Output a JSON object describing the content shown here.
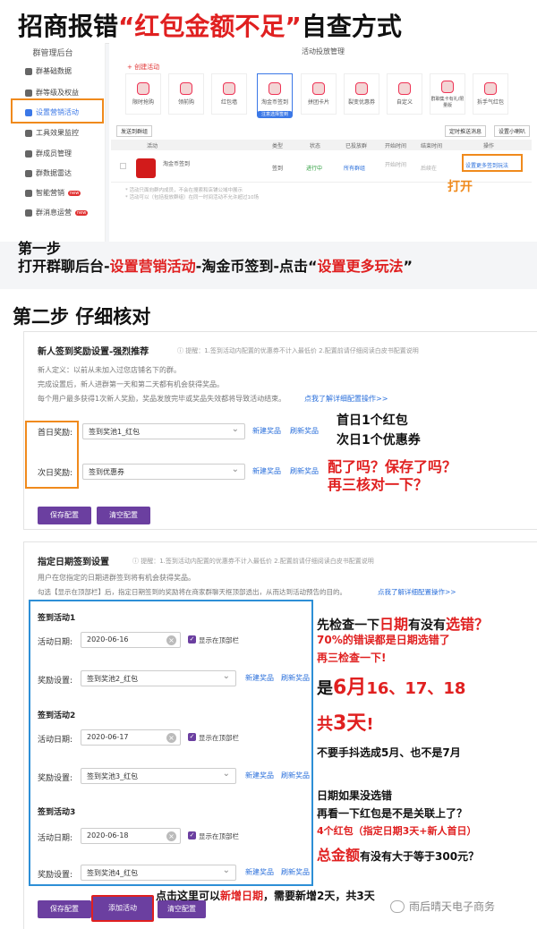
{
  "title": {
    "part1": "招商报错",
    "part2": "“红包金额不足”",
    "part3": "自查方式"
  },
  "admin": {
    "sidebar_title": "群管理后台",
    "sidebar_items": [
      "群基础数据",
      "群等级及权益",
      "设置营销活动",
      "工具效果监控",
      "群成员管理",
      "群数据雷达",
      "智能营销",
      "群消息运营"
    ],
    "badge_new": "new",
    "panel_title": "活动投放管理",
    "create_label": "+ 创建活动",
    "templates": [
      "限时抢购",
      "领前购",
      "红包墙",
      "淘金币签到",
      "拼团卡片",
      "裂变优惠券",
      "自定义",
      "群聊集卡有礼/限量版",
      "拆手气红包"
    ],
    "template_badge": "注意选择签到",
    "btn_send": "发送到群组",
    "btn_push": "定时推送消息",
    "btn_settings": "设置小喇叭",
    "columns": [
      "活动",
      "类型",
      "状态",
      "已投放群",
      "开始时间",
      "结束时间",
      "操作"
    ],
    "row": {
      "name": "淘金币签到",
      "type": "签到",
      "status": "进行中",
      "groups": "所有群组",
      "start": "开始时间",
      "end": "后续在",
      "op": "设置更多签到玩法"
    },
    "notes": [
      "* 活动只面向群内成员，不会在搜索和店铺公域中展示",
      "* 活动可以（包括投放群组）在同一时间活动不允许超过10场"
    ],
    "open_label": "打开"
  },
  "step1": {
    "line1": "第一步",
    "line2_a": "打开群聊后台-",
    "line2_b": "设置营销活动",
    "line2_c": "-淘金币签到-点击“",
    "line2_d": "设置更多玩法",
    "line2_e": "”"
  },
  "step2": "第二步 仔细核对",
  "cfg1": {
    "heading": "新人签到奖励设置-强烈推荐",
    "hint": "ⓘ 提醒：1.签到活动内配置的优惠券不计入最低价 2.配置前请仔细阅读白皮书配置说明",
    "def1": "新人定义：以前从未加入过您店铺名下的群。",
    "def2": "完成设置后，新人进群第一天和第二天都有机会获得奖品。",
    "def3": "每个用户最多获得1次新人奖励，奖品发放完毕或奖品失效都将导致活动结束。",
    "def_link": "点我了解详细配置操作>>",
    "row1_label": "首日奖励:",
    "row1_value": "签到奖池1_红包",
    "row2_label": "次日奖励:",
    "row2_value": "签到优惠券",
    "new_prize": "新建奖品",
    "refresh_prize": "刷新奖品",
    "save": "保存配置",
    "clear": "清空配置",
    "note1": "首日1个红包",
    "note2": "次日1个优惠券",
    "note3": "配了吗？保存了吗？",
    "note4": "再三核对一下？"
  },
  "cfg2": {
    "heading": "指定日期签到设置",
    "hint": "ⓘ 提醒：1.签到活动内配置的优惠券不计入最低价 2.配置前请仔细阅读白皮书配置说明",
    "desc1": "用户在您指定的日期进群签到将有机会获得奖品。",
    "desc2": "勾选【显示在顶部栏】后，指定日期签到的奖励将在商家群聊天框顶部透出，从而达到活动预告的目的。",
    "desc_link": "点我了解详细配置操作>>",
    "activities": [
      {
        "title": "签到活动1",
        "date_label": "活动日期:",
        "date": "2020-06-16",
        "show_top": "显示在顶部栏",
        "prize_label": "奖励设置:",
        "prize": "签到奖池2_红包"
      },
      {
        "title": "签到活动2",
        "date_label": "活动日期:",
        "date": "2020-06-17",
        "show_top": "显示在顶部栏",
        "prize_label": "奖励设置:",
        "prize": "签到奖池3_红包"
      },
      {
        "title": "签到活动3",
        "date_label": "活动日期:",
        "date": "2020-06-18",
        "show_top": "显示在顶部栏",
        "prize_label": "奖励设置:",
        "prize": "签到奖池4_红包"
      }
    ],
    "new_prize": "新建奖品",
    "refresh_prize": "刷新奖品",
    "save": "保存配置",
    "add": "添加活动",
    "clear": "清空配置"
  },
  "notes2": {
    "a1": "先检查一下",
    "a2": "日期",
    "a3": "有没有",
    "a4": "选错？",
    "b": "70%的错误都是日期选错了",
    "c": "再三检查一下!",
    "d1": "是",
    "d2": "6月",
    "d3": "16、17、18",
    "e1": "共",
    "e2": "3天",
    "e3": "!",
    "f": "不要手抖选成5月、也不是7月",
    "g": "日期如果没选错",
    "h": "再看一下红包是不是关联上了？",
    "i": "4个红包（指定日期3天+新人首日）",
    "j1": "总金额",
    "j2": "有没有大于等于300元？",
    "k1": "点击这里可以",
    "k2": "新增日期",
    "k3": "，需要新增2天，共3天"
  },
  "watermark": "雨后晴天电子商务"
}
